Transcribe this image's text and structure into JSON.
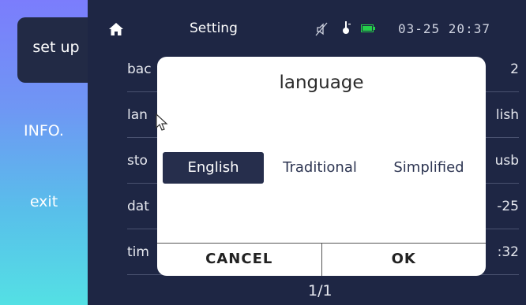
{
  "sidebar": {
    "items": [
      {
        "label": "set up"
      },
      {
        "label": "INFO."
      },
      {
        "label": "exit"
      }
    ]
  },
  "statusbar": {
    "title": "Setting",
    "clock": "03-25 20:37",
    "icons": [
      "home-icon",
      "mute-icon",
      "thermometer-icon",
      "battery-icon"
    ]
  },
  "rows": [
    {
      "label": "bac",
      "value": "2"
    },
    {
      "label": "lan",
      "value": "lish"
    },
    {
      "label": "sto",
      "value": "usb"
    },
    {
      "label": "dat",
      "value": "-25"
    },
    {
      "label": "tim",
      "value": ":32"
    }
  ],
  "pager": "1/1",
  "dialog": {
    "title": "language",
    "options": [
      "English",
      "Traditional",
      "Simplified"
    ],
    "selected": "English",
    "cancel_label": "CANCEL",
    "ok_label": "OK"
  },
  "colors": {
    "background": "#1e2644",
    "accent": "#262e4c",
    "battery": "#25d04a"
  }
}
